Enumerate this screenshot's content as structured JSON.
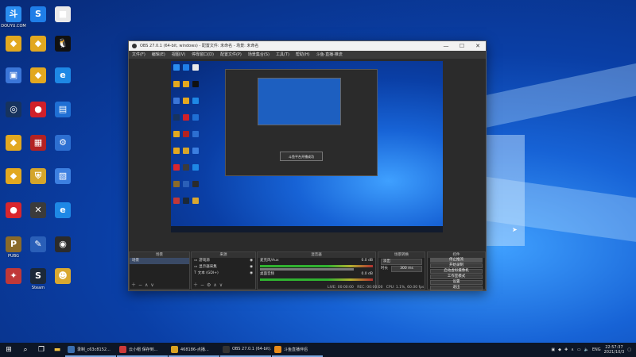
{
  "desktop": {
    "icons": [
      {
        "label": "DOUYU.COM",
        "glyph": "斗",
        "color": "#2a8df0"
      },
      {
        "label": "",
        "glyph": "S",
        "color": "#1f7ee8"
      },
      {
        "label": "",
        "glyph": "■",
        "color": "#e9e9e9"
      },
      {
        "label": "",
        "glyph": "◆",
        "color": "#e2a820"
      },
      {
        "label": "",
        "glyph": "◆",
        "color": "#e2a820"
      },
      {
        "label": "",
        "glyph": "🐧",
        "color": "#111111"
      },
      {
        "label": "",
        "glyph": "▣",
        "color": "#3b76d8"
      },
      {
        "label": "",
        "glyph": "◆",
        "color": "#e2a820"
      },
      {
        "label": "",
        "glyph": "e",
        "color": "#1e88e5"
      },
      {
        "label": "",
        "glyph": "◎",
        "color": "#17335e"
      },
      {
        "label": "",
        "glyph": "●",
        "color": "#d0202a"
      },
      {
        "label": "",
        "glyph": "▤",
        "color": "#1f6fd4"
      },
      {
        "label": "",
        "glyph": "◆",
        "color": "#e2a820"
      },
      {
        "label": "",
        "glyph": "▦",
        "color": "#b32222"
      },
      {
        "label": "",
        "glyph": "⚙",
        "color": "#2d6fd1"
      },
      {
        "label": "",
        "glyph": "◆",
        "color": "#e2a820"
      },
      {
        "label": "",
        "glyph": "⛨",
        "color": "#d4a52b"
      },
      {
        "label": "",
        "glyph": "▧",
        "color": "#3c7fe0"
      },
      {
        "label": "",
        "glyph": "●",
        "color": "#d9262d"
      },
      {
        "label": "",
        "glyph": "✕",
        "color": "#3b3b3b"
      },
      {
        "label": "",
        "glyph": "e",
        "color": "#1e88e5"
      },
      {
        "label": "PUBG",
        "glyph": "P",
        "color": "#8a6a2a"
      },
      {
        "label": "",
        "glyph": "✎",
        "color": "#2a5fb8"
      },
      {
        "label": "",
        "glyph": "◉",
        "color": "#2b2b2b"
      },
      {
        "label": "",
        "glyph": "✦",
        "color": "#c03838"
      },
      {
        "label": "Steam",
        "glyph": "S",
        "color": "#1b2838"
      },
      {
        "label": "",
        "glyph": "☻",
        "color": "#d9a830"
      }
    ]
  },
  "obs": {
    "title": "OBS 27.0.1 (64-bit, windows) - 配置文件: 未命名 - 场景: 未命名",
    "window_controls": [
      "—",
      "☐",
      "✕"
    ],
    "menu": [
      "文件(F)",
      "编辑(E)",
      "视图(V)",
      "停靠窗口(D)",
      "配置文件(P)",
      "场景集合(S)",
      "工具(T)",
      "帮助(H)",
      "斗鱼·直播·推流"
    ],
    "preview_toast": "斗鱼平台开播成功",
    "docks": {
      "scenes": {
        "title": "场景",
        "items": [
          "场景"
        ]
      },
      "sources": {
        "title": "来源",
        "items": [
          "游戏源",
          "显示器采集",
          "文本 (GDI+)"
        ]
      },
      "mixer": {
        "title": "混音器",
        "channels": [
          {
            "name": "麦克风/Aux",
            "db": "0.0 dB"
          },
          {
            "name": "桌面音频",
            "db": "0.0 dB"
          }
        ]
      },
      "transitions": {
        "title": "场景转换",
        "type": "淡出",
        "duration_label": "时长",
        "duration_value": "300 ms"
      },
      "controls": {
        "title": "控件",
        "buttons": [
          "停止推流",
          "开始录制",
          "启动虚拟摄像机",
          "工作室模式",
          "设置",
          "退出"
        ]
      }
    },
    "statusbar": {
      "live": "LIVE: 00:00:00",
      "rec": "REC: 00:00:00",
      "cpu": "CPU: 1.1%, 60.00 fps"
    }
  },
  "taskbar": {
    "apps": [
      {
        "label": "录制_c63c8152...",
        "color": "#3a6fb0"
      },
      {
        "label": "云小帽 保存到...",
        "color": "#cc3a3a"
      },
      {
        "label": "468186-点播...",
        "color": "#d9a220"
      },
      {
        "label": "OBS 27.0.1 (64-bit)...",
        "color": "#333333"
      },
      {
        "label": "斗鱼直播伴侣",
        "color": "#e88b1a"
      }
    ],
    "lang": "ENG",
    "time": "22:57:37",
    "date": "2021/10/3"
  }
}
